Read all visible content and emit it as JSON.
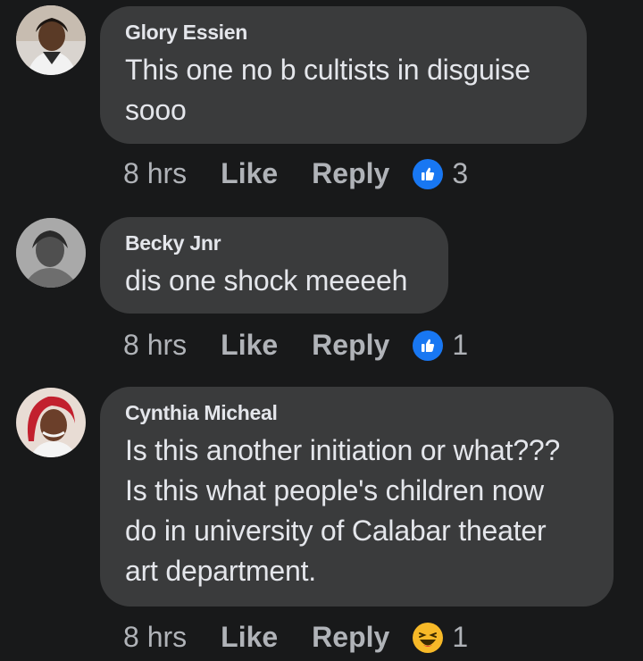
{
  "colors": {
    "background": "#18191a",
    "bubble": "#3a3b3c",
    "text": "#e4e6eb",
    "muted": "#b0b3b8",
    "like_blue": "#1877f2",
    "haha_yellow": "#f7b928"
  },
  "comments": [
    {
      "author": "Glory Essien",
      "text": "This one no b cultists in disguise\nsooo",
      "time": "8 hrs",
      "like_label": "Like",
      "reply_label": "Reply",
      "reaction_icon": "thumbs-up-icon",
      "reaction_count": "3"
    },
    {
      "author": "Becky Jnr",
      "text": "dis one shock meeeeh",
      "time": "8 hrs",
      "like_label": "Like",
      "reply_label": "Reply",
      "reaction_icon": "thumbs-up-icon",
      "reaction_count": "1"
    },
    {
      "author": "Cynthia Micheal",
      "text": "Is this another initiation or what???\nIs this what people's children now\ndo in university of Calabar theater\nart department.",
      "time": "8 hrs",
      "like_label": "Like",
      "reply_label": "Reply",
      "reaction_icon": "laughing-emoji-icon",
      "reaction_count": "1"
    }
  ]
}
